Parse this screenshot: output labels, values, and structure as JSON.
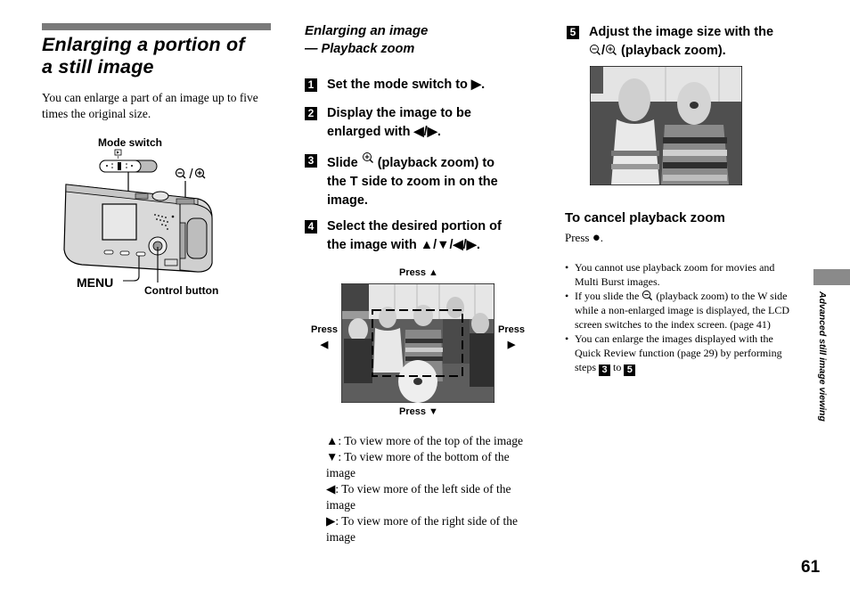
{
  "left": {
    "title": "Enlarging a portion of a still image",
    "title_line1": "Enlarging a portion of",
    "title_line2": "a still image",
    "intro": "You can enlarge a part of an image up to five times the original size.",
    "illustration": {
      "mode_switch_label": "Mode switch",
      "zoom_label": "/",
      "menu_label": "MENU",
      "control_button_label": "Control button"
    }
  },
  "middle": {
    "subtitle_line1": "Enlarging an image",
    "subtitle_line2": "— Playback zoom",
    "steps": [
      {
        "num": "1",
        "lines": [
          "Set the mode switch to ▶."
        ]
      },
      {
        "num": "2",
        "lines": [
          "Display the image to be",
          "enlarged with ◀/▶."
        ]
      },
      {
        "num": "3",
        "lines": [
          "Slide",
          " (playback zoom) to",
          "the T side to zoom in on the",
          "image."
        ]
      },
      {
        "num": "4",
        "lines": [
          "Select the desired portion of",
          "the image with ▲/▼/◀/▶."
        ]
      }
    ],
    "press_labels": {
      "up": "Press ▲",
      "down": "Press ▼",
      "left_word": "Press",
      "left_arrow": "◀",
      "right_word": "Press",
      "right_arrow": "▶"
    },
    "descriptions": [
      {
        "arrow": "▲",
        "text": ": To view more of the top of the image"
      },
      {
        "arrow": "▼",
        "text": ": To view more of the bottom of the image"
      },
      {
        "arrow": "◀",
        "text": ": To view more of the left side of the image"
      },
      {
        "arrow": "▶",
        "text": ": To view more of the right side of the image"
      }
    ]
  },
  "right": {
    "step5": {
      "num": "5",
      "line1": "Adjust the image size with the",
      "line2": " (playback zoom)."
    },
    "cancel_title": "To cancel playback zoom",
    "cancel_text": "Press",
    "cancel_symbol": "●",
    "cancel_end": ".",
    "notes": [
      {
        "text": "You cannot use playback zoom for movies and Multi Burst images."
      },
      {
        "text_before": "If you slide the",
        "text_after": " (playback zoom) to the W side while a non-enlarged image is displayed, the LCD screen switches to the index screen. (page 41)"
      },
      {
        "text": "You can enlarge the images displayed with the Quick Review function (page 29) by performing steps",
        "step_from": "3",
        "to_word": "to",
        "step_to": "5"
      }
    ]
  },
  "side_tab_text": "Advanced still image viewing",
  "page_number": "61",
  "colors": {
    "bar_gray": "#7a7a7a",
    "tab_gray": "#8a8a8a",
    "text": "#000000",
    "background": "#ffffff"
  }
}
